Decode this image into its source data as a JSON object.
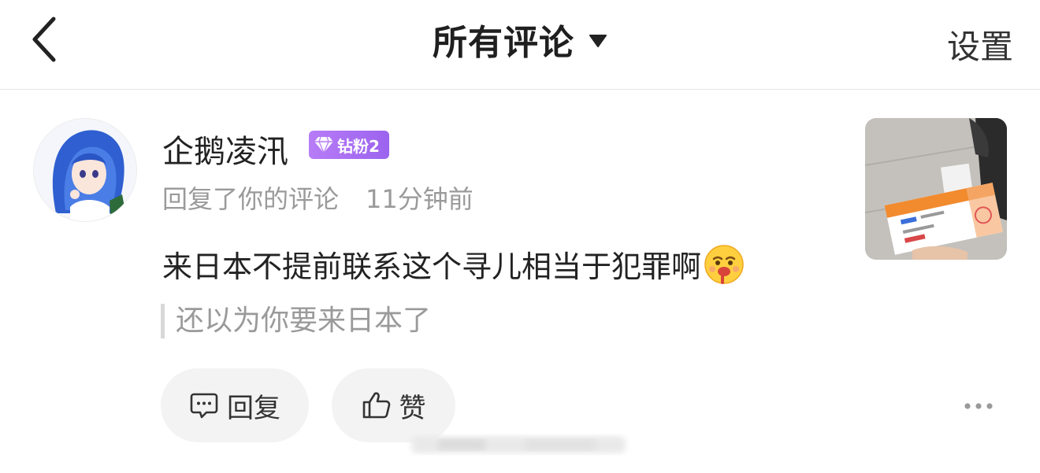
{
  "header": {
    "back_icon": "chevron-left-icon",
    "title": "所有评论",
    "dropdown_icon": "caret-down-icon",
    "settings_label": "设置"
  },
  "comment": {
    "username": "企鹅凌汛",
    "badge": {
      "icon": "diamond-icon",
      "label": "钻粉2",
      "color": "#a56df2"
    },
    "action_text": "回复了你的评论",
    "time": "11分钟前",
    "text": "来日本不提前联系这个寻儿相当于犯罪啊",
    "emoji": "bleeding-face-emoji",
    "quoted_text": "还以为你要来日本了"
  },
  "actions": {
    "reply_label": "回复",
    "reply_icon": "comment-icon",
    "like_label": "赞",
    "like_icon": "thumbs-up-icon",
    "more_icon": "more-dots-icon"
  },
  "colors": {
    "text_primary": "#222222",
    "text_secondary": "#9a9a9a",
    "button_bg": "#f3f3f3",
    "badge_purple": "#a56df2"
  }
}
